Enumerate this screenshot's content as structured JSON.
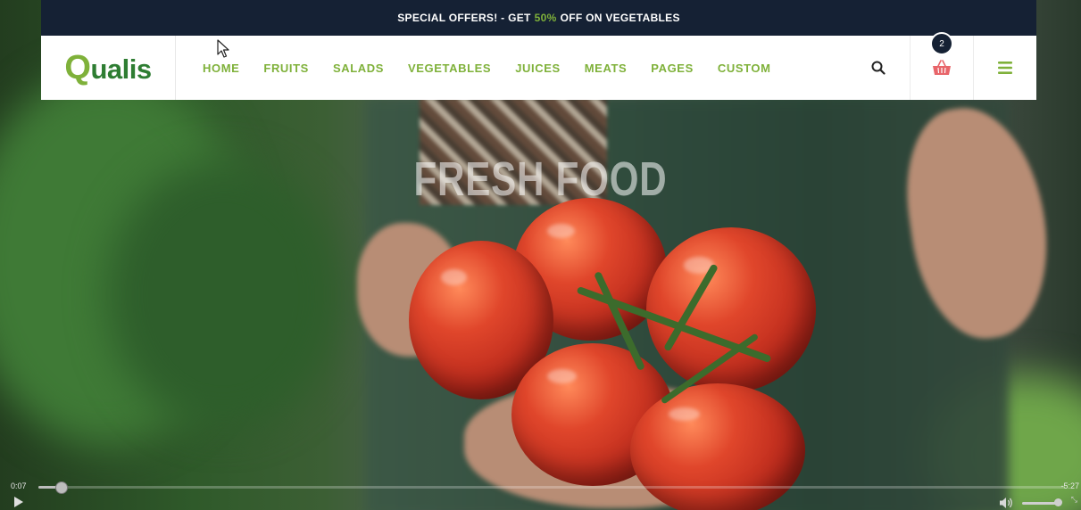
{
  "offer": {
    "prefix": "SPECIAL OFFERS! - GET",
    "accent": "50%",
    "suffix": "OFF ON VEGETABLES"
  },
  "logo": {
    "first": "Q",
    "rest": "ualis"
  },
  "nav": [
    "HOME",
    "FRUITS",
    "SALADS",
    "VEGETABLES",
    "JUICES",
    "MEATS",
    "PAGES",
    "CUSTOM"
  ],
  "cart": {
    "count": "2"
  },
  "hero": {
    "title": "FRESH FOOD"
  },
  "video": {
    "current_time": "0:07",
    "remaining_time": "-5:27",
    "progress": 0.022,
    "volume": 0.9
  },
  "colors": {
    "accent": "#7fb13a",
    "dark": "#152134",
    "logo_rest": "#2e7d32"
  },
  "icons": {
    "search": "search-icon",
    "cart": "basket-icon",
    "menu": "hamburger-icon",
    "play": "play-icon",
    "volume": "volume-icon"
  }
}
